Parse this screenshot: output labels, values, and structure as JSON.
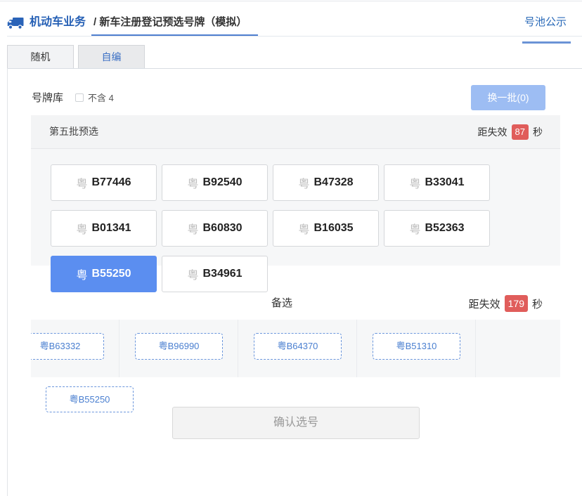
{
  "header": {
    "section": "机动车业务",
    "breadcrumb": "/ 新车注册登记预选号牌（模拟）",
    "pool_link": "号池公示",
    "icon": "truck-icon"
  },
  "tabs": [
    {
      "label": "随机",
      "active": true
    },
    {
      "label": "自编",
      "active": false
    }
  ],
  "library": {
    "label": "号牌库",
    "exclude_four": {
      "label": "不含 4",
      "checked": false
    },
    "refresh_button": "换一批(0)"
  },
  "preselect": {
    "title": "第五批预选",
    "expire": {
      "prefix": "距失效",
      "seconds": "87",
      "suffix": "秒"
    },
    "plates": [
      {
        "province": "粤",
        "number": "B77446",
        "selected": false
      },
      {
        "province": "粤",
        "number": "B92540",
        "selected": false
      },
      {
        "province": "粤",
        "number": "B47328",
        "selected": false
      },
      {
        "province": "粤",
        "number": "B33041",
        "selected": false
      },
      {
        "province": "粤",
        "number": "B01341",
        "selected": false
      },
      {
        "province": "粤",
        "number": "B60830",
        "selected": false
      },
      {
        "province": "粤",
        "number": "B16035",
        "selected": false
      },
      {
        "province": "粤",
        "number": "B52363",
        "selected": false
      },
      {
        "province": "粤",
        "number": "B55250",
        "selected": true
      },
      {
        "province": "粤",
        "number": "B34961",
        "selected": false
      }
    ]
  },
  "alternates": {
    "title": "备选",
    "expire": {
      "prefix": "距失效",
      "seconds": "179",
      "suffix": "秒"
    },
    "plates": [
      "粤B63332",
      "粤B96990",
      "粤B64370",
      "粤B51310"
    ]
  },
  "chosen_plate": "粤B55250",
  "confirm": {
    "label": "确认选号",
    "enabled": false
  },
  "colors": {
    "brand_blue": "#2660b5",
    "selected_bg": "#5b8ef0",
    "badge_red": "#e05d5b",
    "refresh_bg": "#9dbdf3",
    "alt_border": "#6b96dc",
    "alt_text": "#4a7fd0"
  }
}
